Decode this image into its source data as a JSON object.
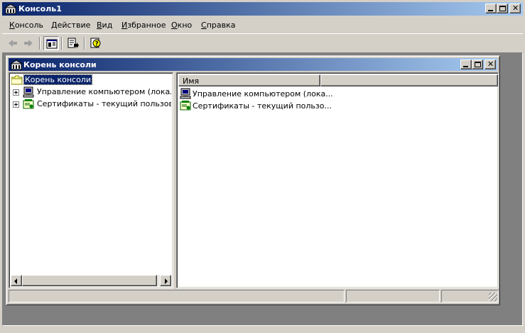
{
  "app": {
    "title": "Консоль1"
  },
  "menu": {
    "items": [
      "Консоль",
      "Действие",
      "Вид",
      "Избранное",
      "Окно",
      "Справка"
    ]
  },
  "toolbar": {
    "buttons": [
      "back-arrow-icon",
      "forward-arrow-icon",
      "show-hide-tree-icon",
      "export-list-icon",
      "help-icon"
    ]
  },
  "child_window": {
    "title": "Корень консоли"
  },
  "tree": {
    "root_label": "Корень консоли",
    "items": [
      {
        "label": "Управление компьютером (локальным)",
        "icon": "computer-management-icon"
      },
      {
        "label": "Сертификаты - текущий пользователь",
        "icon": "certificates-icon"
      }
    ]
  },
  "list": {
    "column_name": "Имя",
    "rows": [
      {
        "label": "Управление компьютером (лока...",
        "icon": "computer-management-icon"
      },
      {
        "label": "Сертификаты - текущий пользо...",
        "icon": "certificates-icon"
      }
    ]
  },
  "colors": {
    "title_active_start": "#0a246a",
    "title_active_end": "#a6caf0",
    "face": "#d4d0c8",
    "mdi_background": "#808080"
  }
}
